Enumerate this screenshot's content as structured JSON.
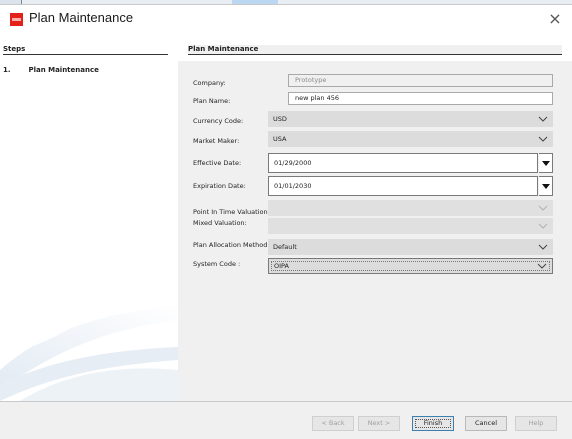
{
  "window": {
    "title": "Plan Maintenance",
    "close_glyph": "×",
    "logo_icon": "oracle-logo-icon"
  },
  "steps": {
    "heading": "Steps",
    "items": [
      {
        "number": "1.",
        "label": "Plan Maintenance"
      }
    ]
  },
  "main": {
    "heading": "Plan Maintenance",
    "fields": {
      "company": {
        "label": "Company:",
        "value": "Prototype"
      },
      "plan_name": {
        "label": "Plan Name:",
        "value": "new plan 456"
      },
      "currency_code": {
        "label": "Currency Code:",
        "value": "USD"
      },
      "market_maker": {
        "label": "Market Maker:",
        "value": "USA"
      },
      "effective_date": {
        "label": "Effective Date:",
        "value": "01/29/2000"
      },
      "expiration_date": {
        "label": "Expiration Date:",
        "value": "01/01/2030"
      },
      "point_in_time_valuation": {
        "label": "Point In Time Valuation:",
        "value": ""
      },
      "mixed_valuation": {
        "label": "Mixed Valuation:",
        "value": ""
      },
      "plan_allocation_method": {
        "label": "Plan Allocation Method :",
        "value": "Default"
      },
      "system_code": {
        "label": "System Code :",
        "value": "OIPA"
      }
    }
  },
  "footer": {
    "back_label": "< Back",
    "next_label": "Next >",
    "finish_label": "Finish",
    "cancel_label": "Cancel",
    "help_label": "Help"
  },
  "colors": {
    "logo_red": "#e32119",
    "panel_bg": "#f0f0f0",
    "select_bg": "#dcdcdc",
    "primary_border": "#3c7fb1"
  }
}
